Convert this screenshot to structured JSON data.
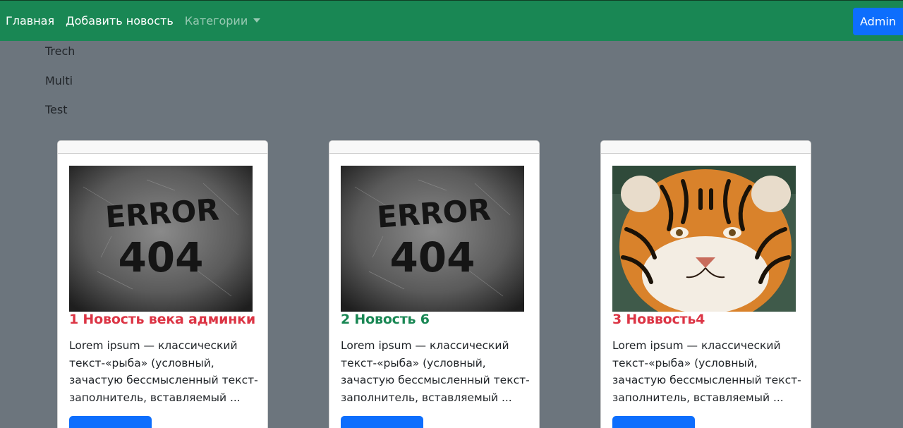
{
  "navbar": {
    "home": "Главная",
    "add_news": "Добавить новость",
    "categories": "Категории",
    "admin": "Admin",
    "colors": {
      "background": "#198754",
      "admin_button": "#0d6efd"
    }
  },
  "categories_menu": [
    "Trech",
    "Multi",
    "Test"
  ],
  "cards": [
    {
      "title": "1 Новость века админки",
      "title_color": "#dc3545",
      "image": "error-404-graffiti",
      "text": "Lorem ipsum — классический текст-«рыба» (условный, зачастую бессмысленный текст-заполнитель, вставляемый ...",
      "button": ""
    },
    {
      "title": "2 Новость 6",
      "title_color": "#198754",
      "image": "error-404-graffiti",
      "text": "Lorem ipsum — классический текст-«рыба» (условный, зачастую бессмысленный текст-заполнитель, вставляемый ...",
      "button": ""
    },
    {
      "title": "3 Новвость4",
      "title_color": "#dc3545",
      "image": "tiger-photo",
      "text": "Lorem ipsum — классический текст-«рыба» (условный, зачастую бессмысленный текст-заполнитель, вставляемый ...",
      "button": ""
    }
  ],
  "page_background": "#6c757d"
}
